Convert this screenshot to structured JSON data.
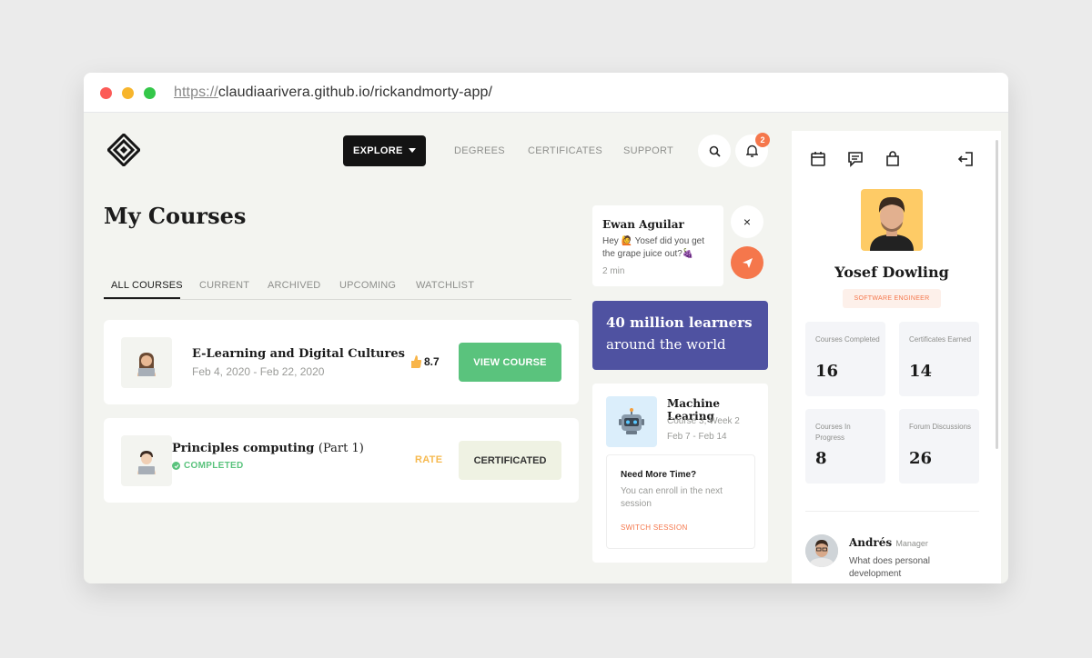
{
  "browser": {
    "url_protocol": "https://",
    "url_rest": "claudiaarivera.github.io/rickandmorty-app/"
  },
  "nav": {
    "explore_label": "EXPLORE",
    "links": [
      "DEGREES",
      "CERTIFICATES",
      "SUPPORT"
    ],
    "notification_count": "2"
  },
  "main": {
    "title": "My Courses",
    "tabs": [
      "ALL COURSES",
      "CURRENT",
      "ARCHIVED",
      "UPCOMING",
      "WATCHLIST"
    ],
    "active_tab": "ALL COURSES",
    "courses": [
      {
        "title": "E-Learning and Digital Cultures",
        "dates": "Feb 4, 2020 - Feb 22, 2020",
        "rating": "8.7",
        "action": "VIEW COURSE"
      },
      {
        "title": "Principles computing",
        "subtitle": "(Part 1)",
        "status": "COMPLETED",
        "rate_label": "RATE",
        "action": "CERTIFICATED"
      }
    ]
  },
  "chat": {
    "name": "Ewan Aguilar",
    "message": "Hey 🙋 Yosef did you get the grape juice out?🍇",
    "time": "2 min",
    "close_label": "×"
  },
  "promo": {
    "line1": "40 million learners",
    "line2": "around the world"
  },
  "machine_card": {
    "title": "Machine Learing",
    "line1": "Course 3, Week 2",
    "line2": "Feb 7 - Feb 14",
    "need_title": "Need More Time?",
    "need_text": "You can enroll in the next session",
    "link": "SWITCH SESSION"
  },
  "profile": {
    "name": "Yosef Dowling",
    "role": "SOFTWARE ENGINEER",
    "stats": [
      {
        "label": "Courses Completed",
        "value": "16"
      },
      {
        "label": "Certificates Earned",
        "value": "14"
      },
      {
        "label": "Courses In Progress",
        "value": "8"
      },
      {
        "label": "Forum Discussions",
        "value": "26"
      }
    ],
    "message": {
      "name": "Andrés",
      "title": "Manager",
      "text": "What does personal development"
    }
  },
  "colors": {
    "accent_orange": "#f5774c",
    "green": "#5ac37d",
    "promo_blue": "#4f52a1",
    "profile_bg": "#fecb66"
  }
}
